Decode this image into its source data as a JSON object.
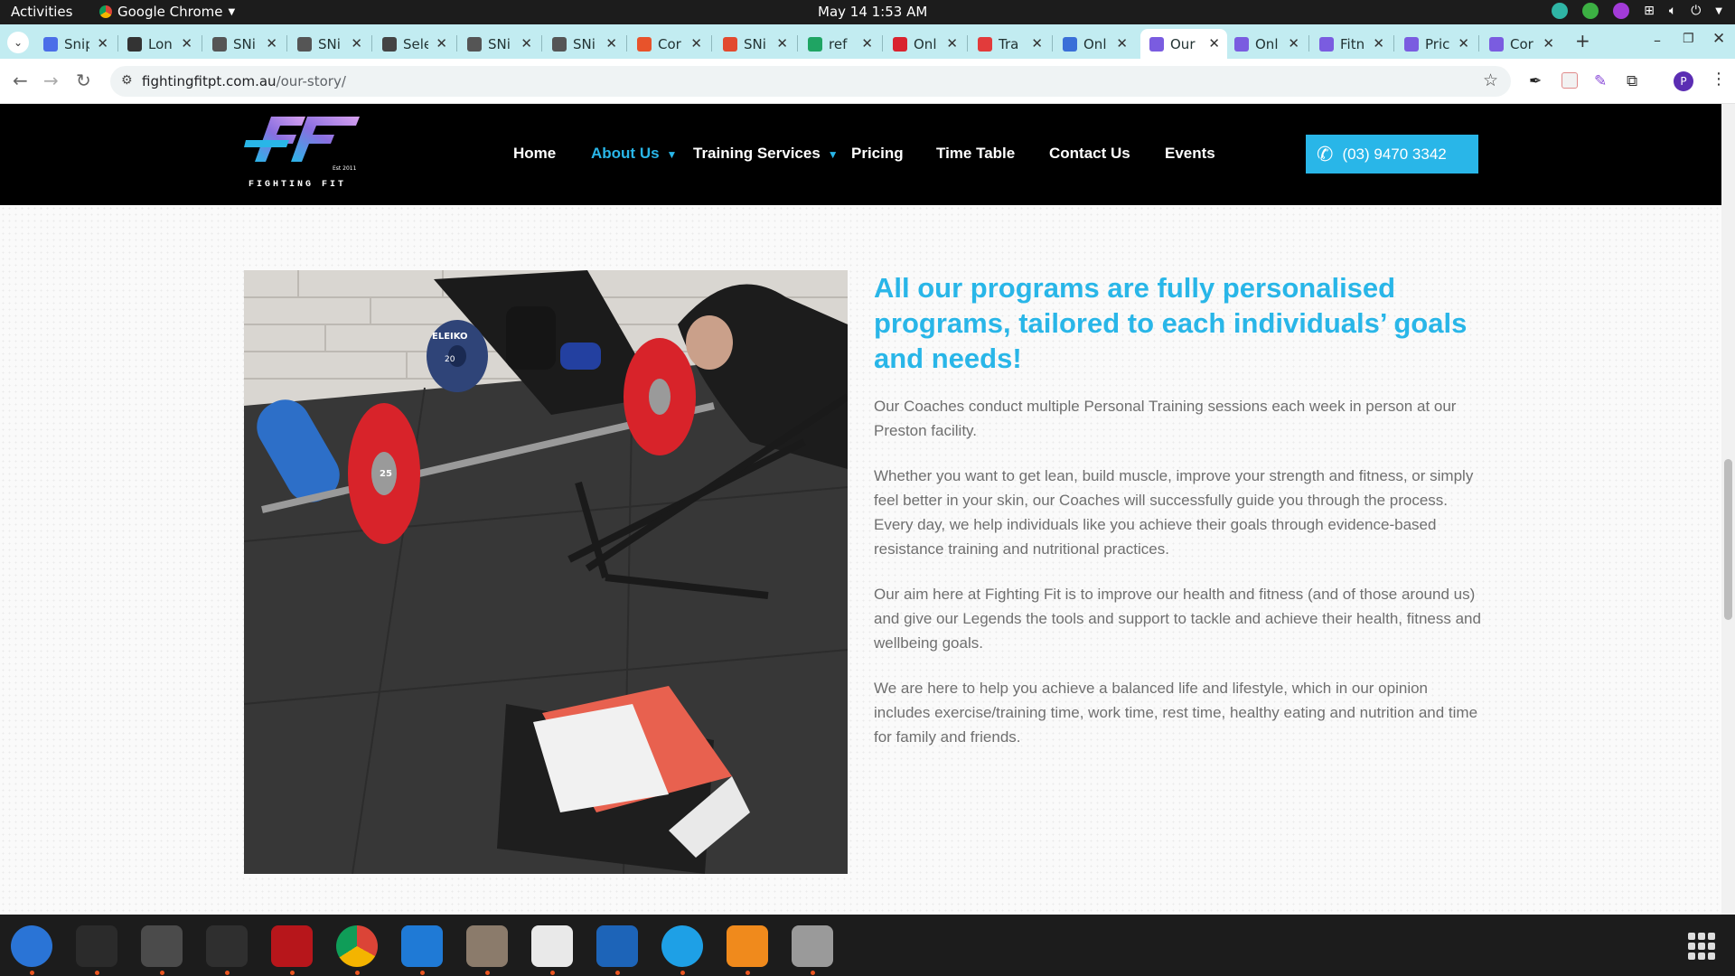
{
  "system": {
    "activities_label": "Activities",
    "app_name": "Google Chrome",
    "clock": "May 14  1:53 AM"
  },
  "tabs": [
    {
      "title": "Snip",
      "favicon_color": "#4b6ee8",
      "active": false
    },
    {
      "title": "Lon",
      "favicon_color": "#333333",
      "active": false
    },
    {
      "title": "SNi",
      "favicon_color": "#555555",
      "active": false
    },
    {
      "title": "SNi",
      "favicon_color": "#555555",
      "active": false
    },
    {
      "title": "Sele",
      "favicon_color": "#444444",
      "active": false
    },
    {
      "title": "SNi",
      "favicon_color": "#555555",
      "active": false
    },
    {
      "title": "SNi",
      "favicon_color": "#555555",
      "active": false
    },
    {
      "title": "Cor",
      "favicon_color": "#e8532b",
      "active": false
    },
    {
      "title": "SNi",
      "favicon_color": "#e24a2f",
      "active": false
    },
    {
      "title": "ref",
      "favicon_color": "#1fa463",
      "active": false
    },
    {
      "title": "Onl",
      "favicon_color": "#d9232f",
      "active": false
    },
    {
      "title": "Tra",
      "favicon_color": "#e23b3b",
      "active": false
    },
    {
      "title": "Onl",
      "favicon_color": "#3a6fd8",
      "active": false
    },
    {
      "title": "Our",
      "favicon_color": "#7a5ce0",
      "active": true
    },
    {
      "title": "Onl",
      "favicon_color": "#7a5ce0",
      "active": false
    },
    {
      "title": "Fitn",
      "favicon_color": "#7a5ce0",
      "active": false
    },
    {
      "title": "Pric",
      "favicon_color": "#7a5ce0",
      "active": false
    },
    {
      "title": "Cor",
      "favicon_color": "#7a5ce0",
      "active": false
    }
  ],
  "browser": {
    "url_domain": "fightingfitpt.com.au",
    "url_path": "/our-story/",
    "profile_initial": "P"
  },
  "site": {
    "logo_text": "FIGHTING FIT",
    "logo_est": "Est 2011",
    "menu": [
      {
        "label": "Home",
        "active": false,
        "dropdown": false
      },
      {
        "label": "About Us",
        "active": true,
        "dropdown": true
      },
      {
        "label": "Training Services",
        "active": false,
        "dropdown": true
      },
      {
        "label": "Pricing",
        "active": false,
        "dropdown": false
      },
      {
        "label": "Time Table",
        "active": false,
        "dropdown": false
      },
      {
        "label": "Contact Us",
        "active": false,
        "dropdown": false
      },
      {
        "label": "Events",
        "active": false,
        "dropdown": false
      }
    ],
    "phone": "(03) 9470 3342",
    "heading": "All our programs are fully personalised programs, tailored to each individuals’ goals and needs!",
    "paragraphs": [
      "Our Coaches conduct multiple Personal Training sessions each week in person at our Preston facility.",
      "Whether you want to get lean, build muscle, improve your strength and fitness, or simply feel better in your skin, our Coaches will successfully guide you through the process. Every day, we help individuals like you achieve their goals through evidence-based resistance training and nutritional practices.",
      "Our aim here at Fighting Fit is to improve our health and fitness (and of those around us) and give our Legends the tools and support to tackle and achieve their health, fitness and wellbeing goals.",
      "We are here to help you achieve a balanced life and lifestyle, which in our opinion includes exercise/training time, work time, rest time, healthy eating and nutrition and time for family and friends."
    ],
    "photo_plate_labels": [
      "ELEIKO",
      "20",
      "25"
    ],
    "accent_color": "#29b6e8"
  },
  "dock": [
    {
      "name": "thunderbird",
      "color": "#2a74d6"
    },
    {
      "name": "terminal",
      "color": "#2b2b2b"
    },
    {
      "name": "calculator",
      "color": "#4b4b4b"
    },
    {
      "name": "system-monitor",
      "color": "#2f2f2f"
    },
    {
      "name": "filezilla",
      "color": "#b7161b"
    },
    {
      "name": "chrome",
      "color": "#3a3a3a"
    },
    {
      "name": "vscode",
      "color": "#1f7ad6"
    },
    {
      "name": "files",
      "color": "#8b7b6b"
    },
    {
      "name": "text-editor",
      "color": "#e9e9e9"
    },
    {
      "name": "libreoffice-writer",
      "color": "#1d64b8"
    },
    {
      "name": "skype",
      "color": "#1ea0e6"
    },
    {
      "name": "rhythmbox",
      "color": "#f08a1c"
    },
    {
      "name": "disks",
      "color": "#9a9a9a"
    }
  ]
}
